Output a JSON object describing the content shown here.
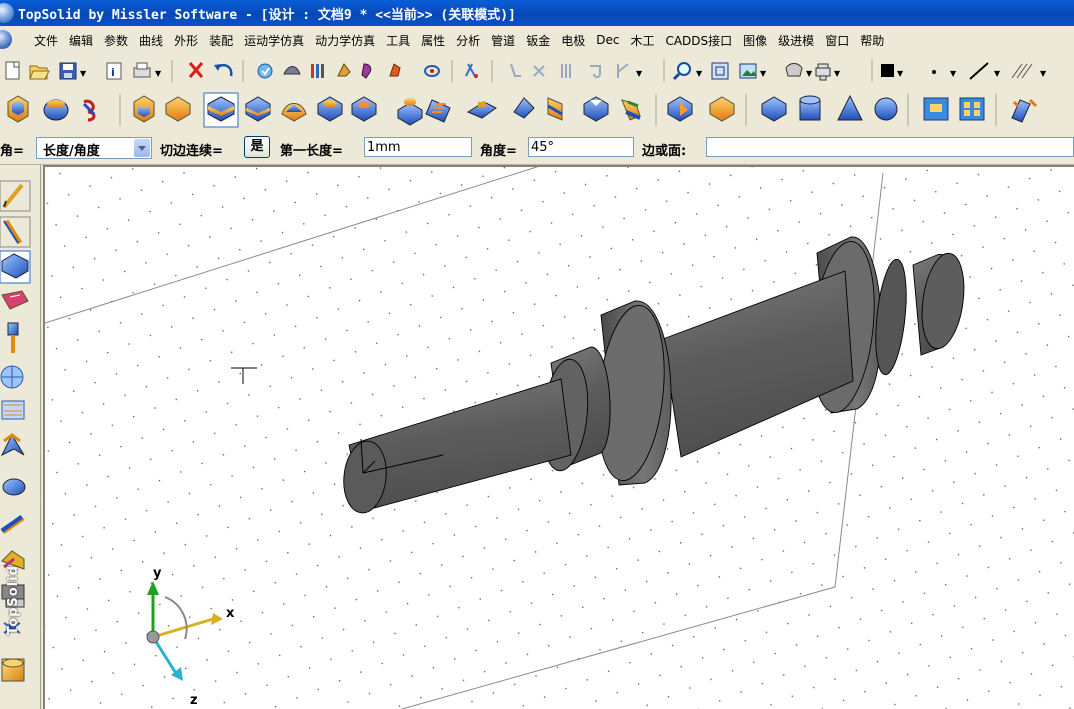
{
  "window": {
    "title": "TopSolid by Missler Software - [设计 : 文档9 *  <<当前>> (关联模式)]"
  },
  "menu": {
    "items": [
      "文件",
      "编辑",
      "参数",
      "曲线",
      "外形",
      "装配",
      "运动学仿真",
      "动力学仿真",
      "工具",
      "属性",
      "分析",
      "管道",
      "钣金",
      "电极",
      "Dec",
      "木工",
      "CADDS接口",
      "图像",
      "级进模",
      "窗口",
      "帮助"
    ]
  },
  "toolbar_standard": {
    "icons": [
      "new-icon",
      "open-icon",
      "save-icon",
      "properties-icon",
      "print-icon",
      "delete-icon",
      "undo-icon",
      "refresh-icon",
      "sweep-icon",
      "ruler-icon",
      "pick-icon",
      "layers-icon",
      "paint-icon",
      "measure-icon",
      "magnet-icon",
      "curve-icon",
      "cross-icon",
      "grid-icon",
      "hook-icon",
      "draw-icon",
      "zoom-icon",
      "fit-icon",
      "photo-icon",
      "render-icon",
      "print-preview-icon",
      "color-icon",
      "point-icon",
      "line-icon",
      "hatch-icon"
    ]
  },
  "toolbar_shape": {
    "icons": [
      "extrude-icon",
      "revolve-icon",
      "spring-icon",
      "box-icon",
      "drape-icon",
      "fillet-icon",
      "chamfer-icon",
      "shell-icon",
      "boss-icon",
      "pocket-icon",
      "hole-icon",
      "thread-icon",
      "rib-icon",
      "draft-icon",
      "split-icon",
      "cut-icon",
      "sweep-shape-icon",
      "mirror-icon",
      "cube-icon",
      "cylinder-icon",
      "cone-icon",
      "sphere-icon",
      "transform-icon",
      "pattern-icon",
      "pipe-icon"
    ]
  },
  "property_bar": {
    "mode_label": "倒角=",
    "mode_value": "长度/角度",
    "tangent_label": "切边连续=",
    "tangent_value": "是",
    "first_length_label": "第一长度=",
    "first_length_value": "1mm",
    "angle_label": "角度=",
    "angle_value": "45°",
    "edge_label": "边或面:",
    "edge_value": ""
  },
  "left_toolbar": {
    "icons": [
      "sketch-icon",
      "curve-tool-icon",
      "shape-tool-icon",
      "sheet-metal-icon",
      "pin-icon",
      "globe-icon",
      "component-icon",
      "surface-icon",
      "mold-icon",
      "wire-icon",
      "bend-icon",
      "vise-icon",
      "joint-icon",
      "material-icon"
    ]
  },
  "viewport": {
    "axis_x": "x",
    "axis_y": "y",
    "axis_z": "z",
    "side_label": "TopSolid"
  },
  "colors": {
    "titlebar": "#0a52c8",
    "shaft": "#646464",
    "background": "#ece9d8"
  }
}
